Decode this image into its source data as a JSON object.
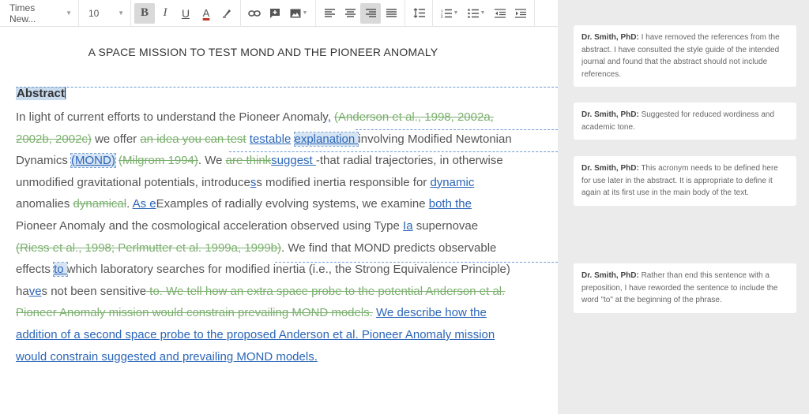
{
  "toolbar": {
    "font_family": "Times New...",
    "font_size": "10",
    "bold": "B",
    "italic": "I",
    "underline": "U",
    "text_color": "A",
    "active_color": "#d9d9d9"
  },
  "document": {
    "title": "A SPACE MISSION TO TEST MOND AND THE PIONEER ANOMALY",
    "abstract_heading": "Abstract",
    "segments": [
      {
        "t": "n",
        "v": "In light of current efforts to understand the Pioneer Anomaly"
      },
      {
        "t": "ins",
        "v": ","
      },
      {
        "t": "n",
        "v": " "
      },
      {
        "t": "del",
        "v": "(Anderson et al., 1998, 2002a, 2002b, 2002c)"
      },
      {
        "t": "n",
        "v": " we offer "
      },
      {
        "t": "del",
        "v": "an idea you can test"
      },
      {
        "t": "n",
        "v": " "
      },
      {
        "t": "ins",
        "v": "testable"
      },
      {
        "t": "n",
        "v": " "
      },
      {
        "t": "ins hl",
        "v": "explanation "
      },
      {
        "t": "n",
        "v": "involving Modified Newtonian Dynamics "
      },
      {
        "t": "ins hl",
        "v": "(MOND)"
      },
      {
        "t": "n",
        "v": " "
      },
      {
        "t": "del",
        "v": "(Milgrom 1994)"
      },
      {
        "t": "n",
        "v": ". We "
      },
      {
        "t": "del",
        "v": "are think"
      },
      {
        "t": "ins",
        "v": "suggest "
      },
      {
        "t": "n",
        "v": "-that radial trajectories, in otherwise unmodified gravitational potentials, introduce"
      },
      {
        "t": "ins",
        "v": "s"
      },
      {
        "t": "n",
        "v": "s modified inertia responsible for "
      },
      {
        "t": "ins",
        "v": "dynamic "
      },
      {
        "t": "n",
        "v": "anomalies "
      },
      {
        "t": "del",
        "v": "dynamical"
      },
      {
        "t": "n",
        "v": ". "
      },
      {
        "t": "ins",
        "v": "As e"
      },
      {
        "t": "n",
        "v": "Examples of radially evolving systems, we examine "
      },
      {
        "t": "ins",
        "v": "both the "
      },
      {
        "t": "n",
        "v": "Pioneer Anomaly and the cosmological acceleration observed using Type "
      },
      {
        "t": "ins",
        "v": "Ia"
      },
      {
        "t": "n",
        "v": " supernovae "
      },
      {
        "t": "del",
        "v": "(Riess et al., 1998; Perlmutter et al. 1999a, 1999b)"
      },
      {
        "t": "n",
        "v": ". We find that MOND predicts observable effects "
      },
      {
        "t": "ins hl",
        "v": "to "
      },
      {
        "t": "n",
        "v": "which laboratory searches for modified inertia (i.e., the Strong Equivalence Principle) ha"
      },
      {
        "t": "ins",
        "v": "ve"
      },
      {
        "t": "n",
        "v": "s not been sensitive"
      },
      {
        "t": "del",
        "v": " to. We tell how an extra space probe to the potential Anderson et al. Pioneer Anomaly mission would constrain prevailing MOND models."
      },
      {
        "t": "n",
        "v": " "
      },
      {
        "t": "ins",
        "v": "We describe how the addition of a second space probe to the proposed Anderson et al. Pioneer Anomaly mission would constrain suggested and prevailing MOND models."
      }
    ]
  },
  "comments": [
    {
      "author": "Dr. Smith, PhD:",
      "text": " I have removed the references from the abstract. I have consulted the style guide of the intended journal and found that the abstract should not include references."
    },
    {
      "author": "Dr. Smith, PhD:",
      "text": " Suggested for reduced wordiness and academic tone."
    },
    {
      "author": "Dr. Smith, PhD:",
      "text": " This acronym needs to be defined here for use later in the abstract. It is appropriate to define it again at its first use in the main body of the text."
    },
    {
      "author": "Dr. Smith, PhD:",
      "text": " Rather than end this sentence with a preposition, I have reworded the sentence to include the word \"to\" at the beginning of the phrase."
    }
  ],
  "colors": {
    "deleted": "#7bb06e",
    "inserted": "#2b66b8",
    "pane_bg": "#ebebeb"
  }
}
